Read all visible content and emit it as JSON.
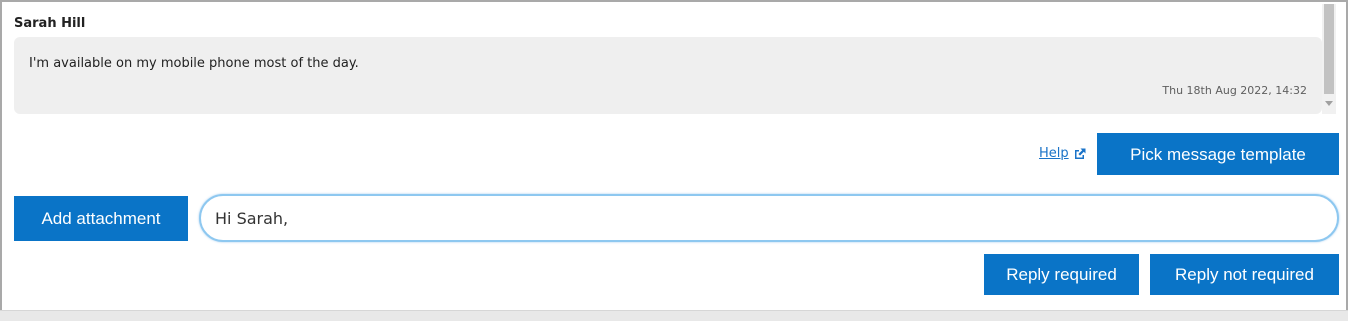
{
  "thread": {
    "sender_name": "Sarah Hill",
    "message_text": "I'm available on my mobile phone most of the day.",
    "message_time": "Thu 18th Aug 2022, 14:32"
  },
  "toolbar": {
    "help_label": "Help",
    "pick_template_label": "Pick message template"
  },
  "composer": {
    "attach_label": "Add attachment",
    "input_value": "Hi Sarah,",
    "reply_required_label": "Reply required",
    "reply_not_required_label": "Reply not required"
  },
  "colors": {
    "primary_button": "#0a74c7",
    "link": "#1a73c8",
    "bubble_bg": "#efefef",
    "input_border": "#8ec8f0"
  },
  "icons": {
    "help_external": "external-link-icon"
  }
}
